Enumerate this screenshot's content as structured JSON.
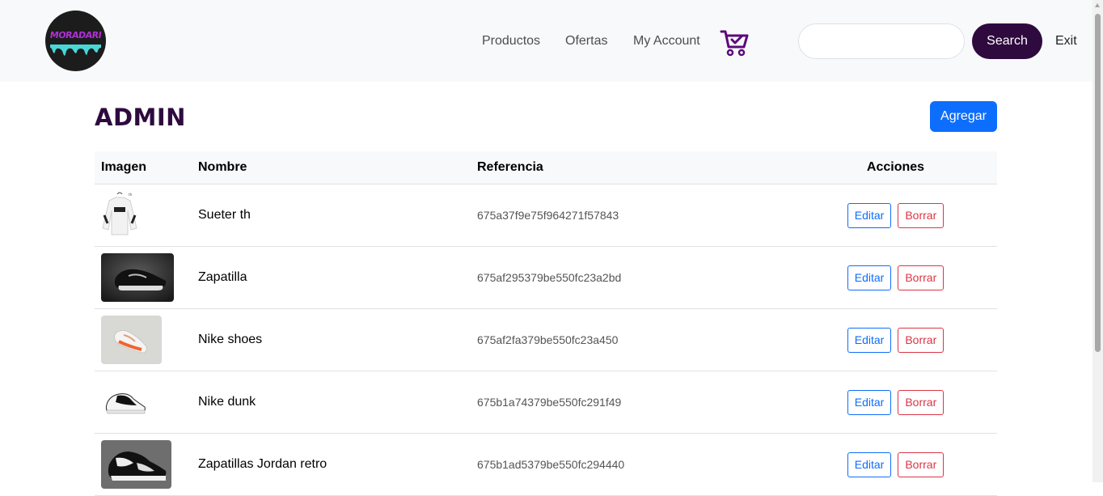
{
  "navbar": {
    "logo_text": "MORADARI",
    "links": [
      "Productos",
      "Ofertas",
      "My Account"
    ],
    "cart_icon": "cart-check-icon",
    "search_placeholder": "",
    "search_value": "",
    "search_button": "Search",
    "exit_label": "Exit"
  },
  "page": {
    "title": "ADMIN",
    "add_button": "Agregar"
  },
  "table": {
    "headers": [
      "Imagen",
      "Nombre",
      "Referencia",
      "Acciones"
    ],
    "rows": [
      {
        "image": "sweater-photo",
        "name": "Sueter th",
        "ref": "675a37f9e75f964271f57843",
        "edit": "Editar",
        "delete": "Borrar"
      },
      {
        "image": "black-sneaker-photo",
        "name": "Zapatilla",
        "ref": "675af295379be550fc23a2bd",
        "edit": "Editar",
        "delete": "Borrar"
      },
      {
        "image": "orange-white-sneaker-photo",
        "name": "Nike shoes",
        "ref": "675af2fa379be550fc23a450",
        "edit": "Editar",
        "delete": "Borrar"
      },
      {
        "image": "black-white-dunk-photo",
        "name": "Nike dunk",
        "ref": "675b1a74379be550fc291f49",
        "edit": "Editar",
        "delete": "Borrar"
      },
      {
        "image": "jordan-retro-photo",
        "name": "Zapatillas Jordan retro",
        "ref": "675b1ad5379be550fc294440",
        "edit": "Editar",
        "delete": "Borrar"
      }
    ]
  },
  "colors": {
    "brand_dark": "#2e0a3f",
    "primary": "#0d6efd",
    "danger": "#dc3545",
    "navbar_bg": "#f8f9fa"
  }
}
